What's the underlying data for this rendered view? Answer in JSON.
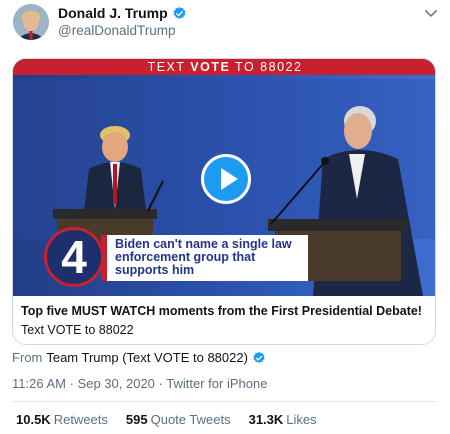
{
  "author": {
    "name": "Donald J. Trump",
    "handle": "@realDonaldTrump"
  },
  "card": {
    "banner_prefix": "TEXT ",
    "banner_keyword": "VOTE",
    "banner_suffix": " TO 88022",
    "overlay_number": "4",
    "overlay_text": "Biden can't name a single law enforcement group that supports him",
    "title": "Top five MUST WATCH moments from the First Presidential Debate!",
    "subtitle": "Text VOTE to 88022"
  },
  "source": {
    "prefix": "From",
    "name": "Team Trump (Text VOTE to 88022)"
  },
  "meta": {
    "time": "11:26 AM",
    "separator1": "·",
    "date": "Sep 30, 2020",
    "separator2": "·",
    "client": "Twitter for iPhone"
  },
  "stats": {
    "retweets_count": "10.5K",
    "retweets_label": "Retweets",
    "quotes_count": "595",
    "quotes_label": "Quote Tweets",
    "likes_count": "31.3K",
    "likes_label": "Likes"
  },
  "colors": {
    "verified": "#1d9bf0",
    "banner": "#c8202f",
    "play": "#1d9bf0"
  },
  "icons": [
    "verified-badge-icon",
    "chevron-down-icon",
    "play-icon"
  ]
}
